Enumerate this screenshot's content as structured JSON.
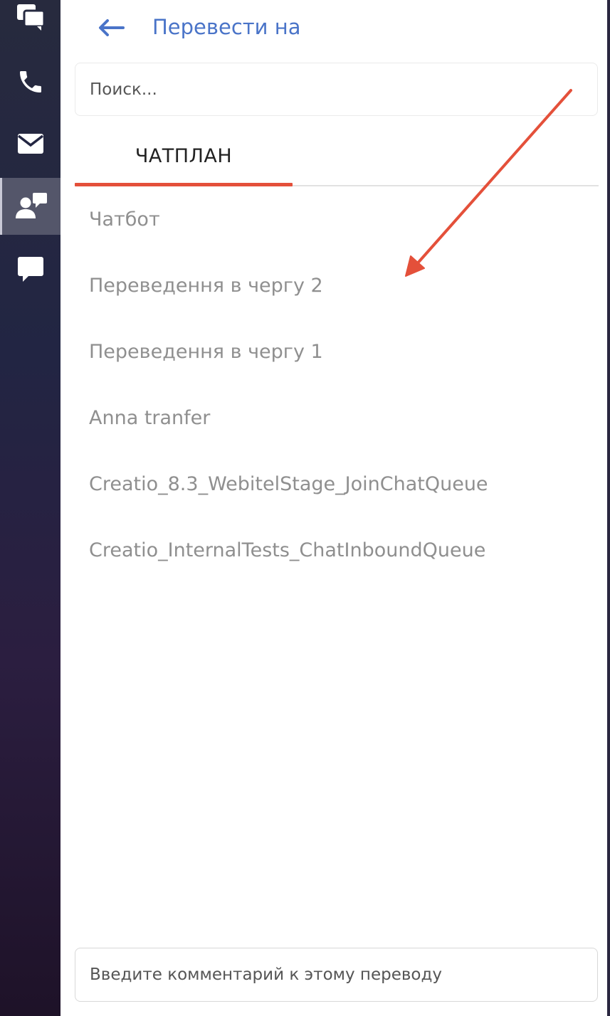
{
  "header": {
    "back_icon": "arrow-left-icon",
    "title": "Перевести на"
  },
  "search": {
    "placeholder": "Поиск..."
  },
  "tabs": [
    {
      "label": "ЧАТПЛАН",
      "active": true
    }
  ],
  "list": [
    {
      "label": "Чатбот"
    },
    {
      "label": "Переведення в чергу 2"
    },
    {
      "label": "Переведення в чергу 1"
    },
    {
      "label": "Anna tranfer"
    },
    {
      "label": "Creatio_8.3_WebitelStage_JoinChatQueue"
    },
    {
      "label": "Creatio_InternalTests_ChatInboundQueue"
    }
  ],
  "comment": {
    "placeholder": "Введите комментарий к этому переводу"
  },
  "rail": {
    "items": [
      {
        "icon": "chats-icon",
        "active": false
      },
      {
        "icon": "phone-icon",
        "active": false
      },
      {
        "icon": "mail-icon",
        "active": false
      },
      {
        "icon": "contact-chat-icon",
        "active": true
      },
      {
        "icon": "chat-bubble-icon",
        "active": false
      }
    ]
  },
  "colors": {
    "accent": "#4a74c8",
    "tab_indicator": "#e4503a",
    "annotation_arrow": "#e4503a"
  }
}
